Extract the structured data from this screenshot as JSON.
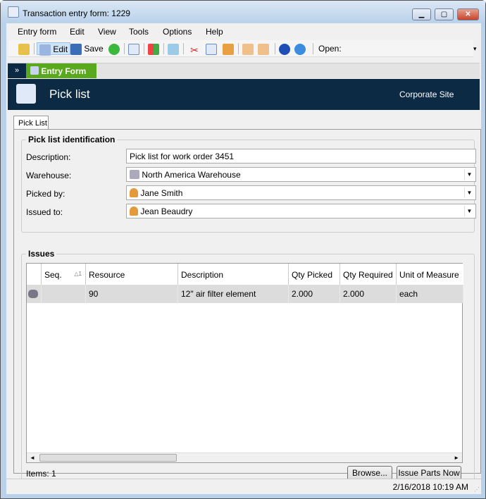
{
  "window": {
    "title": "Transaction entry form: 1229",
    "minimize": "▁",
    "maximize": "▢",
    "close": "✕"
  },
  "menu": [
    "Entry form",
    "Edit",
    "View",
    "Tools",
    "Options",
    "Help"
  ],
  "toolbar": {
    "edit": "Edit",
    "save": "Save",
    "open_label": "Open:"
  },
  "nav": {
    "collapse": "»",
    "tab": "Entry Form"
  },
  "header": {
    "title": "Pick list",
    "site": "Corporate Site"
  },
  "tab": "Pick List",
  "ident": {
    "title": "Pick list identification",
    "description_label": "Description:",
    "description": "Pick list for work order 3451",
    "warehouse_label": "Warehouse:",
    "warehouse": "North America Warehouse",
    "picked_label": "Picked by:",
    "picked": "Jane Smith",
    "issued_label": "Issued to:",
    "issued": "Jean Beaudry"
  },
  "issues": {
    "title": "Issues",
    "columns": [
      "Seq.",
      "Resource",
      "Description",
      "Qty Picked",
      "Qty Required",
      "Unit of Measure"
    ],
    "sort_indicator": "1",
    "rows": [
      {
        "seq": "",
        "resource": "90",
        "description": "12\" air filter element",
        "qty_picked": "2.000",
        "qty_required": "2.000",
        "uom": "each"
      }
    ],
    "items": "Items: 1",
    "browse": "Browse...",
    "issue": "Issue Parts Now"
  },
  "status": {
    "datetime": "2/16/2018 10:19 AM"
  }
}
